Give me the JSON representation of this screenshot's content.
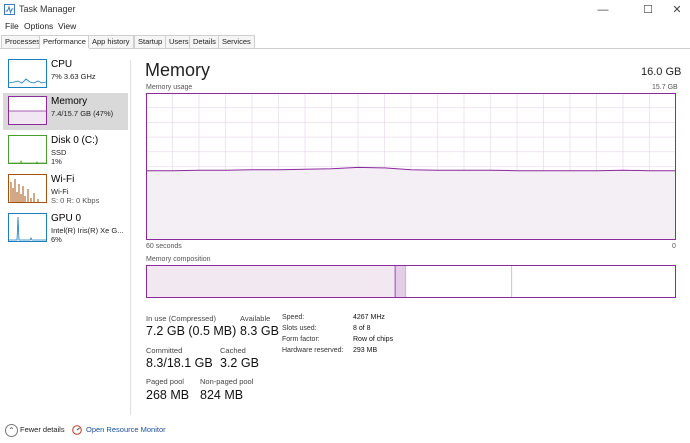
{
  "window": {
    "title": "Task Manager",
    "controls": [
      "—",
      "☐",
      "✕"
    ]
  },
  "menu": [
    "File",
    "Options",
    "View"
  ],
  "tabs": [
    "Processes",
    "Performance",
    "App history",
    "Startup",
    "Users",
    "Details",
    "Services"
  ],
  "active_tab": "Performance",
  "sidebar": [
    {
      "title": "CPU",
      "sub1": "7%  3.63 GHz",
      "sub2": "",
      "sub3": "",
      "color": "#1a7fc0",
      "active": false
    },
    {
      "title": "Memory",
      "sub1": "7.4/15.7 GB (47%)",
      "sub2": "",
      "sub3": "",
      "color": "#8b2a9b",
      "active": true
    },
    {
      "title": "Disk 0 (C:)",
      "sub1": "SSD",
      "sub2": "1%",
      "sub3": "",
      "color": "#4aa02c",
      "active": false
    },
    {
      "title": "Wi-Fi",
      "sub1": "Wi-Fi",
      "sub2": "S: 0  R: 0 Kbps",
      "sub3": "",
      "color": "#a7520c",
      "active": false
    },
    {
      "title": "GPU 0",
      "sub1": "Intel(R) Iris(R) Xe G...",
      "sub2": "6%",
      "sub3": "",
      "color": "#1a7fc0",
      "active": false
    }
  ],
  "main": {
    "title": "Memory",
    "total": "16.0 GB",
    "usage_label": "Memory usage",
    "usage_max": "15.7 GB",
    "time_left": "60 seconds",
    "time_right": "0",
    "composition_label": "Memory composition"
  },
  "stats": {
    "in_use_label": "In use (Compressed)",
    "in_use_value": "7.2 GB (0.5 MB)",
    "available_label": "Available",
    "available_value": "8.3 GB",
    "committed_label": "Committed",
    "committed_value": "8.3/18.1 GB",
    "cached_label": "Cached",
    "cached_value": "3.2 GB",
    "paged_label": "Paged pool",
    "paged_value": "268 MB",
    "nonpaged_label": "Non-paged pool",
    "nonpaged_value": "824 MB"
  },
  "specs": {
    "speed_label": "Speed:",
    "speed_value": "4267 MHz",
    "slots_label": "Slots used:",
    "slots_value": "8 of 8",
    "form_label": "Form factor:",
    "form_value": "Row of chips",
    "reserved_label": "Hardware reserved:",
    "reserved_value": "293 MB"
  },
  "footer": {
    "fewer_details": "Fewer details",
    "open_monitor": "Open Resource Monitor"
  },
  "chart_data": {
    "type": "area",
    "ylim": [
      0,
      15.7
    ],
    "unit": "GB",
    "x": [
      60,
      57,
      54,
      51,
      48,
      45,
      42,
      39,
      36,
      33,
      30,
      27,
      24,
      21,
      18,
      15,
      12,
      9,
      6,
      3,
      0
    ],
    "values": [
      7.4,
      7.4,
      7.45,
      7.45,
      7.5,
      7.5,
      7.55,
      7.6,
      7.75,
      7.7,
      7.5,
      7.45,
      7.45,
      7.45,
      7.4,
      7.4,
      7.4,
      7.4,
      7.45,
      7.4,
      7.4
    ],
    "composition": {
      "in_use_fraction": 0.47,
      "modified_fraction": 0.02,
      "standby_fraction": 0.2
    }
  },
  "colors": {
    "memory": "#8b2a9b",
    "memory_fill": "#f4eef5",
    "grid": "#e3d6e6",
    "active_item": "#d9d9d9"
  }
}
